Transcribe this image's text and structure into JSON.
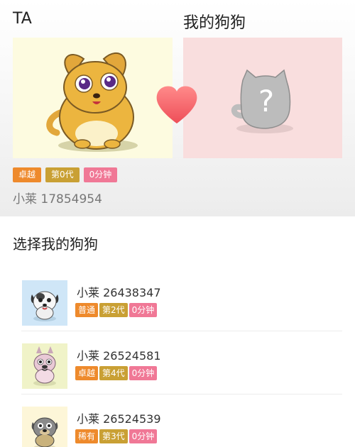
{
  "header": {
    "ta_label": "TA",
    "mine_label": "我的狗狗"
  },
  "ta": {
    "name": "小莱 17854954",
    "badges": [
      "卓越",
      "第0代",
      "0分钟"
    ]
  },
  "mine": {
    "placeholder_icon": "question-cat-icon"
  },
  "section_title": "选择我的狗狗",
  "dogs": [
    {
      "name": "小莱 26438347",
      "tags": [
        "普通",
        "第2代",
        "0分钟"
      ]
    },
    {
      "name": "小莱 26524581",
      "tags": [
        "卓越",
        "第4代",
        "0分钟"
      ]
    },
    {
      "name": "小莱 26524539",
      "tags": [
        "稀有",
        "第3代",
        "0分钟"
      ]
    }
  ],
  "colors": {
    "rarity": "#ee8a2c",
    "generation": "#c9a034",
    "time": "#f07896",
    "ta_bg": "#fdfbe0",
    "mine_bg": "#f9dede"
  }
}
